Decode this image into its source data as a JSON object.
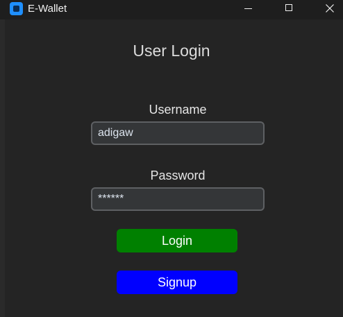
{
  "window": {
    "title": "E-Wallet"
  },
  "form": {
    "heading": "User Login",
    "username_label": "Username",
    "username_value": "adigaw",
    "password_label": "Password",
    "password_display": "******"
  },
  "buttons": {
    "login_label": "Login",
    "signup_label": "Signup"
  },
  "icons": {
    "app": "app-icon",
    "minimize": "minimize-icon",
    "maximize": "maximize-icon",
    "close": "close-icon"
  },
  "colors": {
    "login_button": "#008000",
    "signup_button": "#0000ff",
    "background": "#242424"
  }
}
